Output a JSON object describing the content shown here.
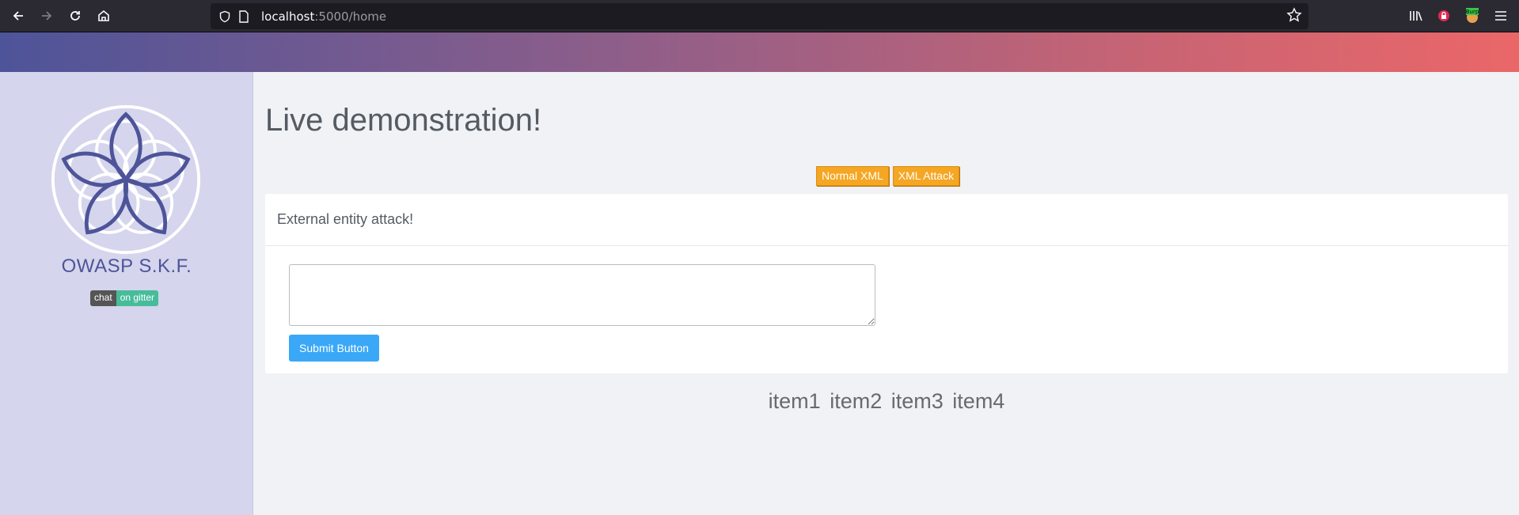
{
  "browser": {
    "url_host": "localhost",
    "url_path": ":5000/home",
    "icons": [
      "back-icon",
      "forward-icon",
      "reload-icon",
      "home-icon",
      "shield-icon",
      "page-icon",
      "star-icon",
      "library-icon",
      "lock-extension-icon",
      "burp-extension-icon",
      "menu-icon"
    ],
    "extension_label": "Burp"
  },
  "sidebar": {
    "brand": "OWASP S.K.F.",
    "gitter_left": "chat",
    "gitter_right": "on gitter",
    "colors": {
      "background": "#d5d5ed",
      "brand": "#4e5499"
    }
  },
  "main": {
    "title": "Live demonstration!",
    "buttons": [
      "Normal XML",
      "XML Attack"
    ],
    "card_title": "External entity attack!",
    "textarea_value": "",
    "submit_label": "Submit Button",
    "items": [
      "item1",
      "item2",
      "item3",
      "item4"
    ]
  },
  "colors": {
    "gradient_start": "#4e5499",
    "gradient_end": "#ea6768",
    "orange_button": "#f5a623",
    "submit_button": "#3aa8f7"
  }
}
